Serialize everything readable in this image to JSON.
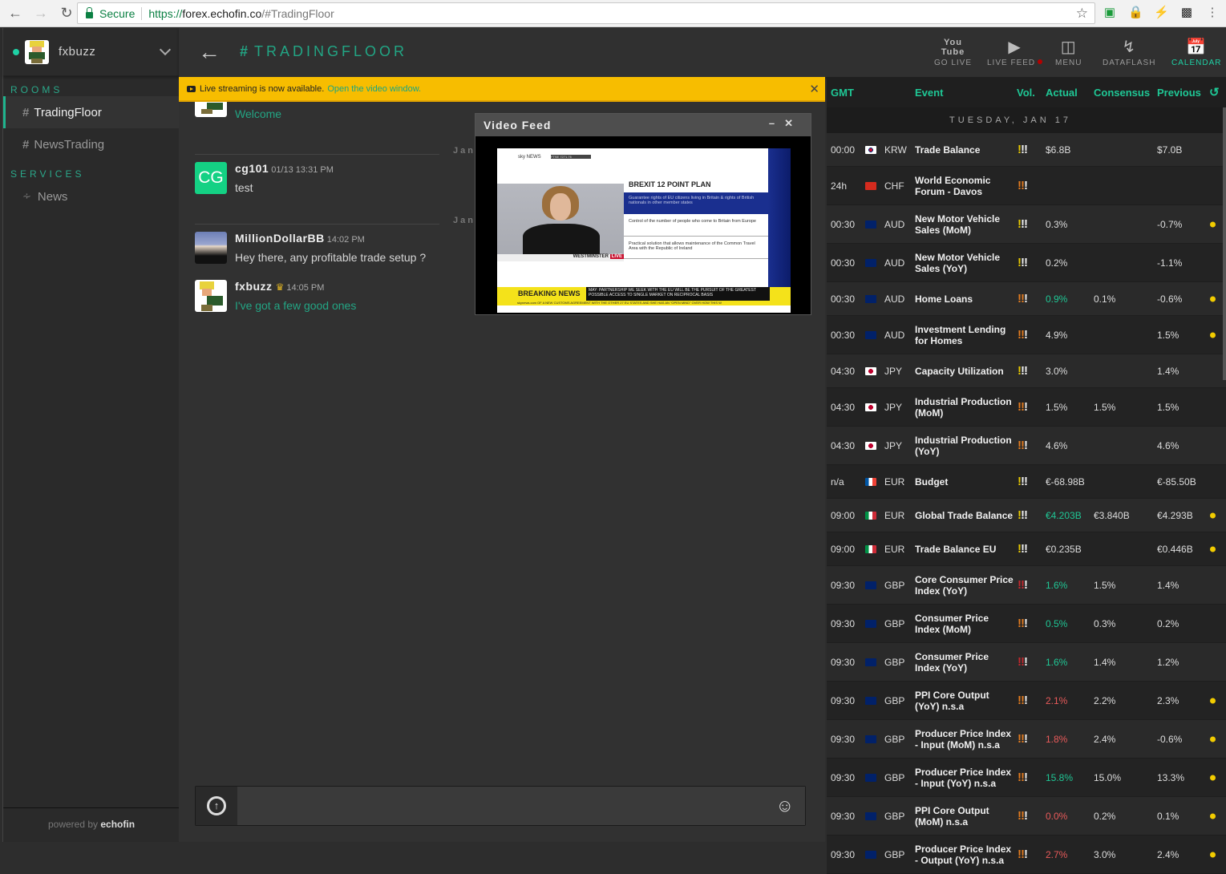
{
  "browser": {
    "secure_label": "Secure",
    "url_scheme": "https://",
    "url_host": "forex.echofin.co",
    "url_path": "/#TradingFloor"
  },
  "sidebar": {
    "username": "fxbuzz",
    "rooms_title": "ROOMS",
    "rooms": [
      {
        "label": "TradingFloor",
        "active": true
      },
      {
        "label": "NewsTrading",
        "active": false
      }
    ],
    "services_title": "SERVICES",
    "services": [
      {
        "label": "News",
        "icon": "rss-icon"
      }
    ],
    "powered_prefix": "powered by",
    "powered_brand": "echofin"
  },
  "header": {
    "room_title": "TRADINGFLOOR",
    "buttons": [
      {
        "label": "GO LIVE",
        "icon": "youtube-icon"
      },
      {
        "label": "LIVE FEED",
        "icon": "play-icon",
        "indicator": "#b40000"
      },
      {
        "label": "MENU",
        "icon": "columns-icon"
      },
      {
        "label": "DATAFLASH",
        "icon": "lightning-icon"
      },
      {
        "label": "CALENDAR",
        "icon": "calendar-icon",
        "active": true
      }
    ]
  },
  "banner": {
    "text": "Live streaming is now available.",
    "link": "Open the video window."
  },
  "chat": {
    "messages": [
      {
        "user": "",
        "time": "",
        "text": "Welcome",
        "teal": true
      },
      {
        "user": "cg101",
        "initials": "CG",
        "time": "01/13 13:31 PM",
        "text": "test"
      },
      {
        "user": "MillionDollarBB",
        "time": "14:02 PM",
        "text": "Hey there, any profitable trade setup ?"
      },
      {
        "user": "fxbuzz",
        "time": "14:05 PM",
        "text": "I've got a few good ones",
        "teal": true
      }
    ],
    "date_labels": [
      "Janu",
      "Janu"
    ],
    "input_placeholder": ""
  },
  "video": {
    "title": "Video Feed",
    "headline": "BREXIT 12 POINT PLAN",
    "points": [
      "Guarantee rights of EU citizens living in Britain & rights of British nationals in other member states",
      "Control of the number of people who come to Britain from Europe",
      "Practical solution that allows maintenance of the Common Travel Area with the Republic of Ireland"
    ],
    "location": "WESTMINSTER",
    "live": "LIVE",
    "breaking": "BREAKING NEWS",
    "breaking_text": "MAY: PARTNERSHIP WE SEEK WITH THE EU WILL BE THE PURSUIT OF THE GREATEST POSSIBLE ACCESS TO SINGLE MARKET ON RECIPROCAL BASIS",
    "ticker": "skynews.com  OF A NEW CUSTOMS AGREEMENT WITH THE OTHER 27 EU STATES AND SHE HAS AN \"OPEN MIND\" OVER HOW THIS W",
    "channel": "sky NEWS",
    "ftse": "FTSE 7271.76"
  },
  "calendar": {
    "headers": {
      "gmt": "GMT",
      "event": "Event",
      "vol": "Vol.",
      "actual": "Actual",
      "consensus": "Consensus",
      "previous": "Previous"
    },
    "date": "TUESDAY, JAN 17",
    "colors": {
      "vol_low": "#e6c800",
      "vol_med": "#e07a1f",
      "vol_high": "#c0282d",
      "positive": "#1fc795",
      "negative": "#e85a5a",
      "dot": "#f2cc00"
    },
    "rows": [
      {
        "time": "00:00",
        "flag": "kr",
        "cur": "KRW",
        "event": "Trade Balance",
        "vol": "low",
        "actual": "$6.8B",
        "actual_tone": "",
        "consensus": "",
        "previous": "$7.0B",
        "dot": false
      },
      {
        "time": "24h",
        "flag": "ch",
        "cur": "CHF",
        "event": "World Economic Forum - Davos",
        "vol": "med",
        "actual": "",
        "actual_tone": "",
        "consensus": "",
        "previous": "",
        "dot": false
      },
      {
        "time": "00:30",
        "flag": "au",
        "cur": "AUD",
        "event": "New Motor Vehicle Sales (MoM)",
        "vol": "low",
        "actual": "0.3%",
        "actual_tone": "",
        "consensus": "",
        "previous": "-0.7%",
        "dot": true
      },
      {
        "time": "00:30",
        "flag": "au",
        "cur": "AUD",
        "event": "New Motor Vehicle Sales (YoY)",
        "vol": "low",
        "actual": "0.2%",
        "actual_tone": "",
        "consensus": "",
        "previous": "-1.1%",
        "dot": false
      },
      {
        "time": "00:30",
        "flag": "au",
        "cur": "AUD",
        "event": "Home Loans",
        "vol": "med",
        "actual": "0.9%",
        "actual_tone": "green",
        "consensus": "0.1%",
        "previous": "-0.6%",
        "dot": true
      },
      {
        "time": "00:30",
        "flag": "au",
        "cur": "AUD",
        "event": "Investment Lending for Homes",
        "vol": "med",
        "actual": "4.9%",
        "actual_tone": "",
        "consensus": "",
        "previous": "1.5%",
        "dot": true
      },
      {
        "time": "04:30",
        "flag": "jp",
        "cur": "JPY",
        "event": "Capacity Utilization",
        "vol": "low",
        "actual": "3.0%",
        "actual_tone": "",
        "consensus": "",
        "previous": "1.4%",
        "dot": false
      },
      {
        "time": "04:30",
        "flag": "jp",
        "cur": "JPY",
        "event": "Industrial Production (MoM)",
        "vol": "med",
        "actual": "1.5%",
        "actual_tone": "",
        "consensus": "1.5%",
        "previous": "1.5%",
        "dot": false
      },
      {
        "time": "04:30",
        "flag": "jp",
        "cur": "JPY",
        "event": "Industrial Production (YoY)",
        "vol": "med",
        "actual": "4.6%",
        "actual_tone": "",
        "consensus": "",
        "previous": "4.6%",
        "dot": false
      },
      {
        "time": "n/a",
        "flag": "fr",
        "cur": "EUR",
        "event": "Budget",
        "vol": "low",
        "actual": "€-68.98B",
        "actual_tone": "",
        "consensus": "",
        "previous": "€-85.50B",
        "dot": false
      },
      {
        "time": "09:00",
        "flag": "it",
        "cur": "EUR",
        "event": "Global Trade Balance",
        "vol": "low",
        "actual": "€4.203B",
        "actual_tone": "green",
        "consensus": "€3.840B",
        "previous": "€4.293B",
        "dot": true
      },
      {
        "time": "09:00",
        "flag": "it",
        "cur": "EUR",
        "event": "Trade Balance EU",
        "vol": "low",
        "actual": "€0.235B",
        "actual_tone": "",
        "consensus": "",
        "previous": "€0.446B",
        "dot": true
      },
      {
        "time": "09:30",
        "flag": "gb",
        "cur": "GBP",
        "event": "Core Consumer Price Index (YoY)",
        "vol": "high",
        "actual": "1.6%",
        "actual_tone": "green",
        "consensus": "1.5%",
        "previous": "1.4%",
        "dot": false
      },
      {
        "time": "09:30",
        "flag": "gb",
        "cur": "GBP",
        "event": "Consumer Price Index (MoM)",
        "vol": "med",
        "actual": "0.5%",
        "actual_tone": "green",
        "consensus": "0.3%",
        "previous": "0.2%",
        "dot": false
      },
      {
        "time": "09:30",
        "flag": "gb",
        "cur": "GBP",
        "event": "Consumer Price Index (YoY)",
        "vol": "high",
        "actual": "1.6%",
        "actual_tone": "green",
        "consensus": "1.4%",
        "previous": "1.2%",
        "dot": false
      },
      {
        "time": "09:30",
        "flag": "gb",
        "cur": "GBP",
        "event": "PPI Core Output (YoY) n.s.a",
        "vol": "med",
        "actual": "2.1%",
        "actual_tone": "red",
        "consensus": "2.2%",
        "previous": "2.3%",
        "dot": true
      },
      {
        "time": "09:30",
        "flag": "gb",
        "cur": "GBP",
        "event": "Producer Price Index - Input (MoM) n.s.a",
        "vol": "med",
        "actual": "1.8%",
        "actual_tone": "red",
        "consensus": "2.4%",
        "previous": "-0.6%",
        "dot": true
      },
      {
        "time": "09:30",
        "flag": "gb",
        "cur": "GBP",
        "event": "Producer Price Index - Input (YoY) n.s.a",
        "vol": "med",
        "actual": "15.8%",
        "actual_tone": "green",
        "consensus": "15.0%",
        "previous": "13.3%",
        "dot": true
      },
      {
        "time": "09:30",
        "flag": "gb",
        "cur": "GBP",
        "event": "PPI Core Output (MoM) n.s.a",
        "vol": "med",
        "actual": "0.0%",
        "actual_tone": "red",
        "consensus": "0.2%",
        "previous": "0.1%",
        "dot": true
      },
      {
        "time": "09:30",
        "flag": "gb",
        "cur": "GBP",
        "event": "Producer Price Index - Output (YoY) n.s.a",
        "vol": "med",
        "actual": "2.7%",
        "actual_tone": "red",
        "consensus": "3.0%",
        "previous": "2.4%",
        "dot": true
      }
    ]
  }
}
